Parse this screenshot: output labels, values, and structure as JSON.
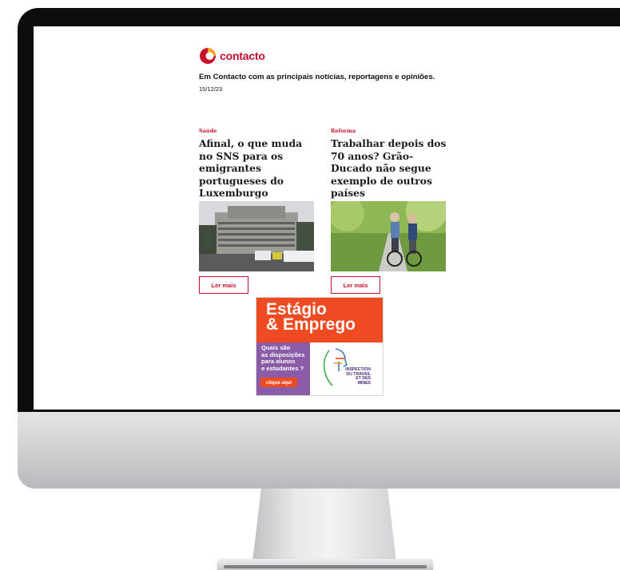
{
  "newsletter": {
    "brand": "contacto",
    "tagline": "Em Contacto com as principais notícias, reportagens e opiniões.",
    "date": "15/12/23",
    "articles": [
      {
        "category": "Saúde",
        "title": "Afinal, o que muda no SNS para os emigrantes portugueses do Luxemburgo",
        "button": "Ler mais",
        "image": "hospital-building"
      },
      {
        "category": "Reforma",
        "title": "Trabalhar depois dos 70 anos? Grão-Ducado não segue exemplo de outros países",
        "button": "Ler mais",
        "image": "seniors-cycling"
      }
    ]
  },
  "ad": {
    "headline_line1": "Estágio",
    "headline_line2": "& Emprego",
    "question": "Quais são\nas disposições\npara alunos\ne estudantes ?",
    "cta": "clique aqui",
    "org": "INSPECTION\nDU TRAVAIL\nET DES MINES"
  },
  "colors": {
    "brand_red": "#c8102e",
    "ad_orange": "#ef4b23",
    "ad_purple": "#8a5ca8"
  }
}
